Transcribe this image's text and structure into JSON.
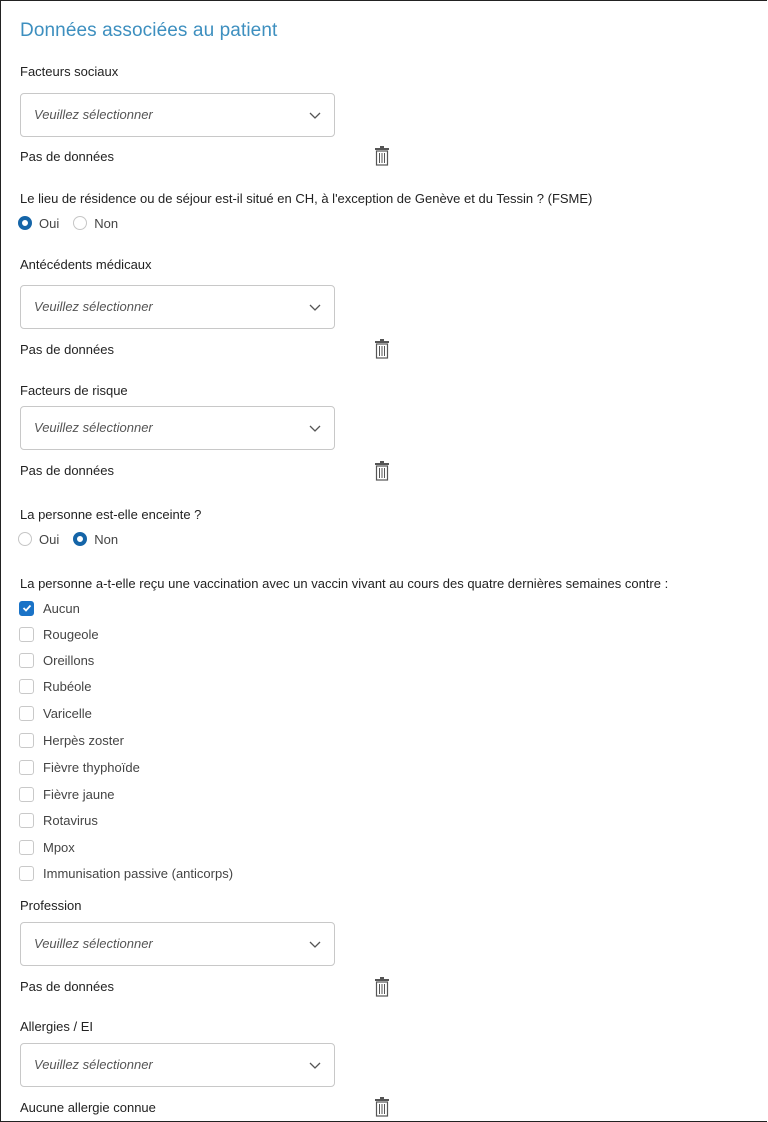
{
  "section_title": "Données associées au patient",
  "placeholder": "Veuillez sélectionner",
  "no_data": "Pas de données",
  "social": {
    "label": "Facteurs sociaux"
  },
  "residence": {
    "question": "Le lieu de résidence ou de séjour est-il situé en CH, à l'exception de Genève et du Tessin ? (FSME)",
    "options": [
      "Oui",
      "Non"
    ],
    "selected": "Oui"
  },
  "medical_history": {
    "label": "Antécédents médicaux"
  },
  "risk_factors": {
    "label": "Facteurs de risque"
  },
  "pregnant": {
    "question": "La personne est-elle enceinte ?",
    "options": [
      "Oui",
      "Non"
    ],
    "selected": "Non"
  },
  "vaccination": {
    "question": "La personne a-t-elle reçu une vaccination avec un vaccin vivant au cours des quatre dernières semaines contre :",
    "items": [
      {
        "label": "Aucun",
        "checked": true
      },
      {
        "label": "Rougeole",
        "checked": false
      },
      {
        "label": "Oreillons",
        "checked": false
      },
      {
        "label": "Rubéole",
        "checked": false
      },
      {
        "label": "Varicelle",
        "checked": false
      },
      {
        "label": "Herpès zoster",
        "checked": false
      },
      {
        "label": "Fièvre thyphoïde",
        "checked": false
      },
      {
        "label": "Fièvre jaune",
        "checked": false
      },
      {
        "label": "Rotavirus",
        "checked": false
      },
      {
        "label": "Mpox",
        "checked": false
      },
      {
        "label": "Immunisation passive (anticorps)",
        "checked": false
      }
    ]
  },
  "profession": {
    "label": "Profession"
  },
  "allergies": {
    "label": "Allergies / EI",
    "status": "Aucune allergie connue"
  },
  "colors": {
    "title": "#3d8fbf",
    "primary": "#1565a8",
    "checkbox": "#1a73c7"
  },
  "icons": {
    "dropdown": "chevron-down-icon",
    "delete": "trash-icon",
    "check": "check-icon"
  }
}
